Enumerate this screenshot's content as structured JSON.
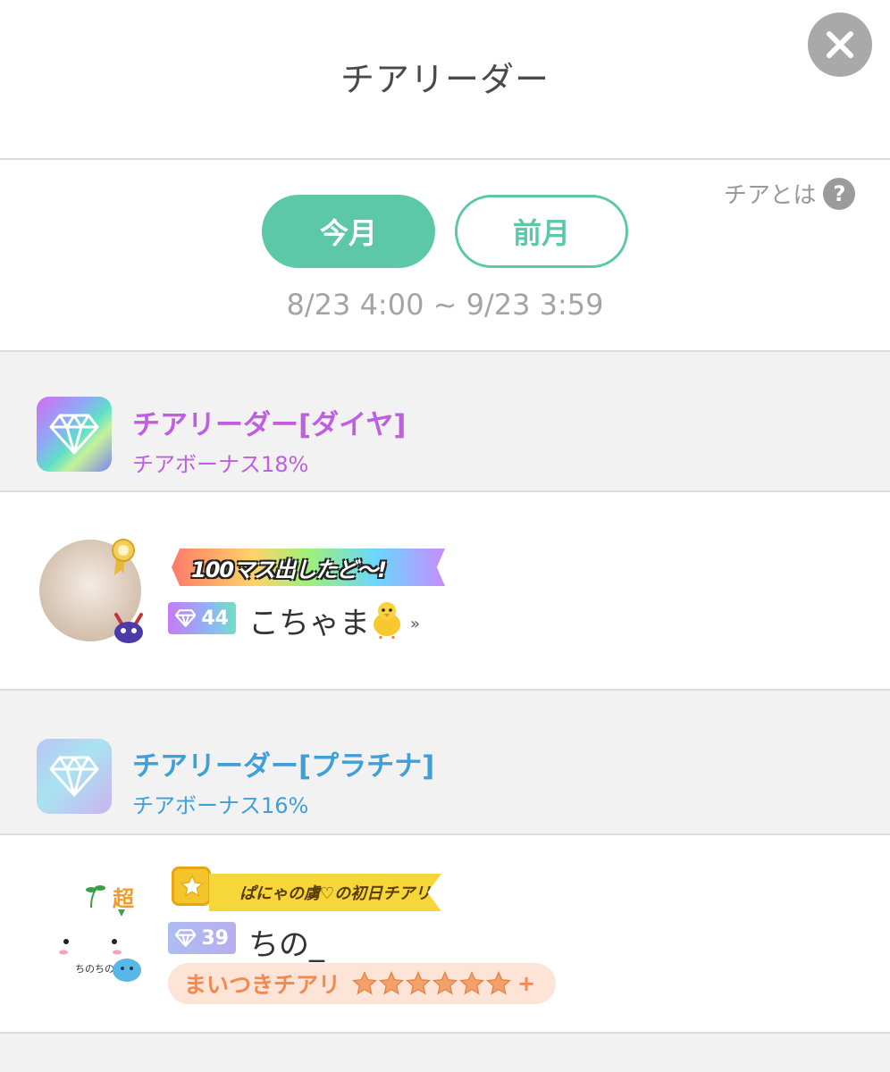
{
  "header": {
    "title": "チアリーダー",
    "close_icon": "close-icon"
  },
  "help": {
    "label": "チアとは",
    "icon": "?"
  },
  "tabs": [
    {
      "label": "今月",
      "selected": true
    },
    {
      "label": "前月",
      "selected": false
    }
  ],
  "period": "8/23 4:00 ~ 9/23 3:59",
  "tiers": [
    {
      "name": "チアリーダー[ダイヤ]",
      "bonus": "チアボーナス18%",
      "color": "#c05ee0",
      "users": [
        {
          "title_banner": "100マス出したど〜!",
          "cheer_count": "44",
          "username": "こちゃま",
          "username_suffix": "»",
          "emoji": "baby-chick-icon"
        }
      ]
    },
    {
      "name": "チアリーダー[プラチナ]",
      "bonus": "チアボーナス16%",
      "color": "#3f9fd8",
      "users": [
        {
          "title_banner": "ぱにゃの虜♡の初日チアリ",
          "cheer_count": "39",
          "username": "ちの_",
          "avatar_text": "超",
          "avatar_caption": "ちのちの",
          "monthly_label": "まいつきチアリ",
          "monthly_stars": 6,
          "monthly_plus": "+"
        }
      ]
    }
  ],
  "colors": {
    "accent": "#5dc8a8",
    "diamond": "#c05ee0",
    "platinum": "#3f9fd8",
    "monthly": "#f08a4e"
  }
}
